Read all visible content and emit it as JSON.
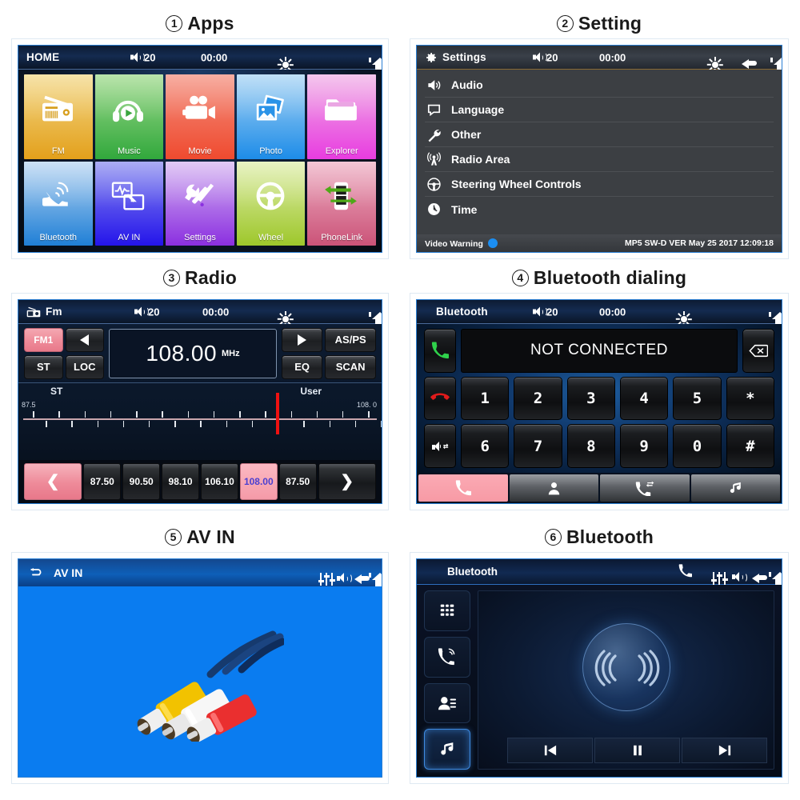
{
  "panels": [
    {
      "num": "1",
      "caption": "Apps",
      "statusbar": {
        "title": "HOME",
        "volume": "20",
        "clock": "00:00"
      },
      "tiles": [
        {
          "label": "FM",
          "icon": "radio-icon",
          "c1": "#f3d888",
          "c2": "#e3a01b"
        },
        {
          "label": "Music",
          "icon": "headphones-icon",
          "c1": "#9fda8c",
          "c2": "#31a83c"
        },
        {
          "label": "Movie",
          "icon": "camcorder-icon",
          "c1": "#f4907f",
          "c2": "#ef4a2f"
        },
        {
          "label": "Photo",
          "icon": "photos-icon",
          "c1": "#a8d4f4",
          "c2": "#1d8ce8"
        },
        {
          "label": "Explorer",
          "icon": "folder-icon",
          "c1": "#f0b0e6",
          "c2": "#e83ce0"
        },
        {
          "label": "Bluetooth",
          "icon": "bt-phone-icon",
          "c1": "#b9d6f2",
          "c2": "#1f7fd6"
        },
        {
          "label": "AV IN",
          "icon": "avin-icon",
          "c1": "#8b8df0",
          "c2": "#2414ea"
        },
        {
          "label": "Settings",
          "icon": "tools-icon",
          "c1": "#d6b6f2",
          "c2": "#8b2fe0"
        },
        {
          "label": "Wheel",
          "icon": "steering-icon",
          "c1": "#dfeeac",
          "c2": "#9ec72b"
        },
        {
          "label": "PhoneLink",
          "icon": "phonelink-icon",
          "c1": "#eeb0c4",
          "c2": "#cb5378"
        }
      ]
    },
    {
      "num": "2",
      "caption": "Setting",
      "statusbar": {
        "title": "Settings",
        "volume": "20",
        "clock": "00:00"
      },
      "items": [
        {
          "label": "Audio",
          "icon": "speaker-icon"
        },
        {
          "label": "Language",
          "icon": "speech-bubble-icon"
        },
        {
          "label": "Other",
          "icon": "wrench-icon"
        },
        {
          "label": "Radio Area",
          "icon": "antenna-icon"
        },
        {
          "label": "Steering Wheel Controls",
          "icon": "steering-wheel-icon"
        },
        {
          "label": "Time",
          "icon": "clock-icon"
        }
      ],
      "footer": {
        "left": "Video Warning",
        "right": "MP5 SW-D VER May 25 2017 12:09:18"
      }
    },
    {
      "num": "3",
      "caption": "Radio",
      "statusbar": {
        "title": "Fm",
        "volume": "20",
        "clock": "00:00"
      },
      "band": "FM1",
      "buttons": {
        "st": "ST",
        "loc": "LOC",
        "asps": "AS/PS",
        "eq": "EQ",
        "scan": "SCAN"
      },
      "frequency": "108.00",
      "unit": "MHz",
      "scale": {
        "left": "87.5",
        "right": "108. 0",
        "stereo": "ST",
        "user": "User",
        "needle_pct": 71
      },
      "presets": [
        "87.50",
        "90.50",
        "98.10",
        "106.10",
        "108.00",
        "87.50"
      ],
      "active_preset_index": 4
    },
    {
      "num": "4",
      "caption": "Bluetooth dialing",
      "statusbar": {
        "title": "Bluetooth",
        "volume": "20",
        "clock": "00:00"
      },
      "display": "NOT CONNECTED",
      "keys_row1": [
        "1",
        "2",
        "3",
        "4",
        "5",
        "*"
      ],
      "keys_row2": [
        "6",
        "7",
        "8",
        "9",
        "0",
        "#"
      ],
      "side": {
        "answer": "call-answer-icon",
        "hangup": "call-end-icon",
        "transfer": "audio-transfer-icon",
        "backspace": "backspace-icon"
      },
      "tabs": [
        "dialpad-phone-icon",
        "contacts-icon",
        "call-history-icon",
        "bt-music-icon"
      ],
      "active_tab_index": 0
    },
    {
      "num": "5",
      "caption": "AV IN",
      "statusbar": {
        "title": "AV IN",
        "icons": [
          "eq-icon",
          "speaker-icon",
          "back-icon",
          "home-icon"
        ]
      }
    },
    {
      "num": "6",
      "caption": "Bluetooth",
      "statusbar": {
        "title": "Bluetooth",
        "icons": [
          "phone-icon",
          "eq-icon",
          "speaker-icon",
          "back-icon",
          "home-icon"
        ]
      },
      "side_buttons": [
        "dialpad-icon",
        "call-icon",
        "contacts-icon",
        "music-icon"
      ],
      "active_side_index": 3,
      "player": [
        "prev-track-icon",
        "pause-icon",
        "next-track-icon"
      ]
    }
  ],
  "colors": {
    "accent_pink": "#f59aa8",
    "needle_red": "#ef1111",
    "av_blue": "#0a7cf0",
    "settings_gray": "#3c3f43"
  }
}
